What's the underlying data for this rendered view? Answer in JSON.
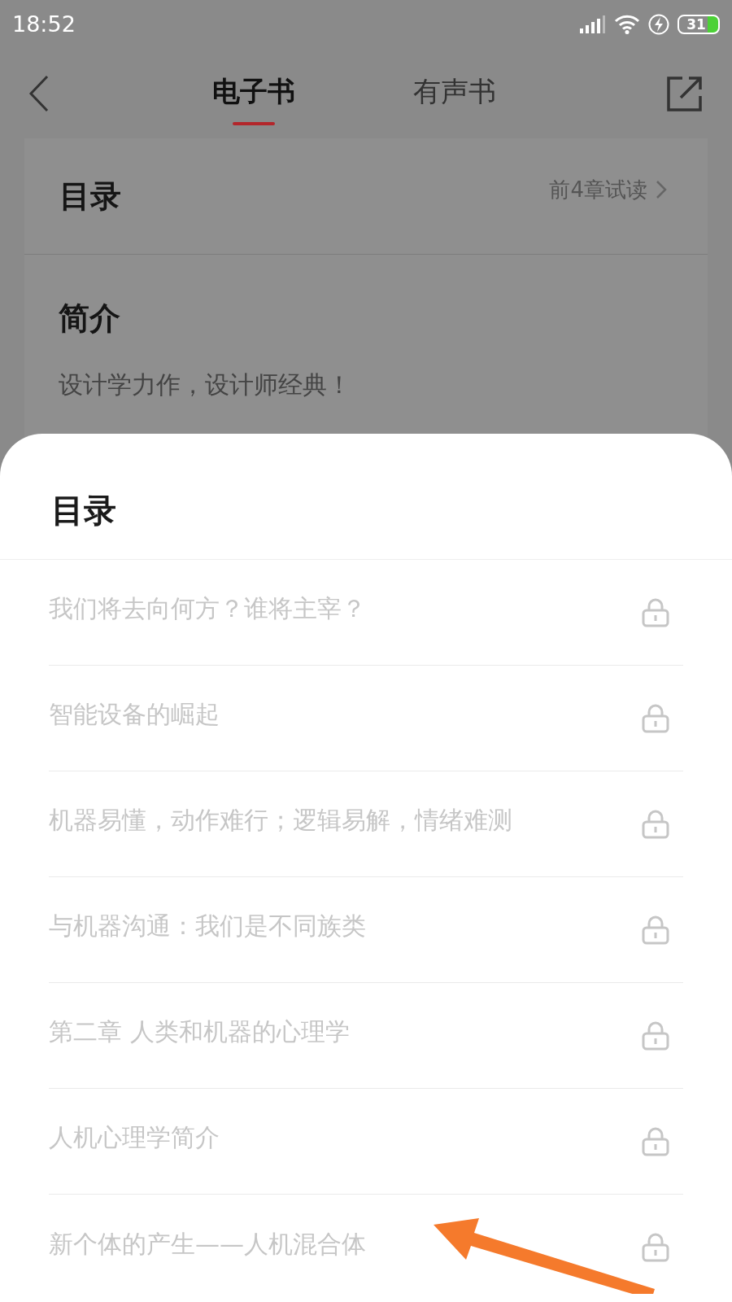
{
  "status_bar": {
    "time": "18:52",
    "battery": "31"
  },
  "tabs": [
    {
      "label": "电子书",
      "selected": true
    },
    {
      "label": "有声书",
      "selected": false
    }
  ],
  "catalog_card": {
    "title": "目录",
    "trial": "前4章试读"
  },
  "intro_card": {
    "title": "简介",
    "text": "设计学力作，设计师经典！"
  },
  "sheet": {
    "title": "目录",
    "chapters": [
      {
        "title": "我们将去向何方？谁将主宰？"
      },
      {
        "title": "智能设备的崛起"
      },
      {
        "title": "机器易懂，动作难行；逻辑易解，情绪难测"
      },
      {
        "title": "与机器沟通：我们是不同族类"
      },
      {
        "title": "第二章 人类和机器的心理学"
      },
      {
        "title": "人机心理学简介"
      },
      {
        "title": "新个体的产生——人机混合体"
      }
    ]
  }
}
